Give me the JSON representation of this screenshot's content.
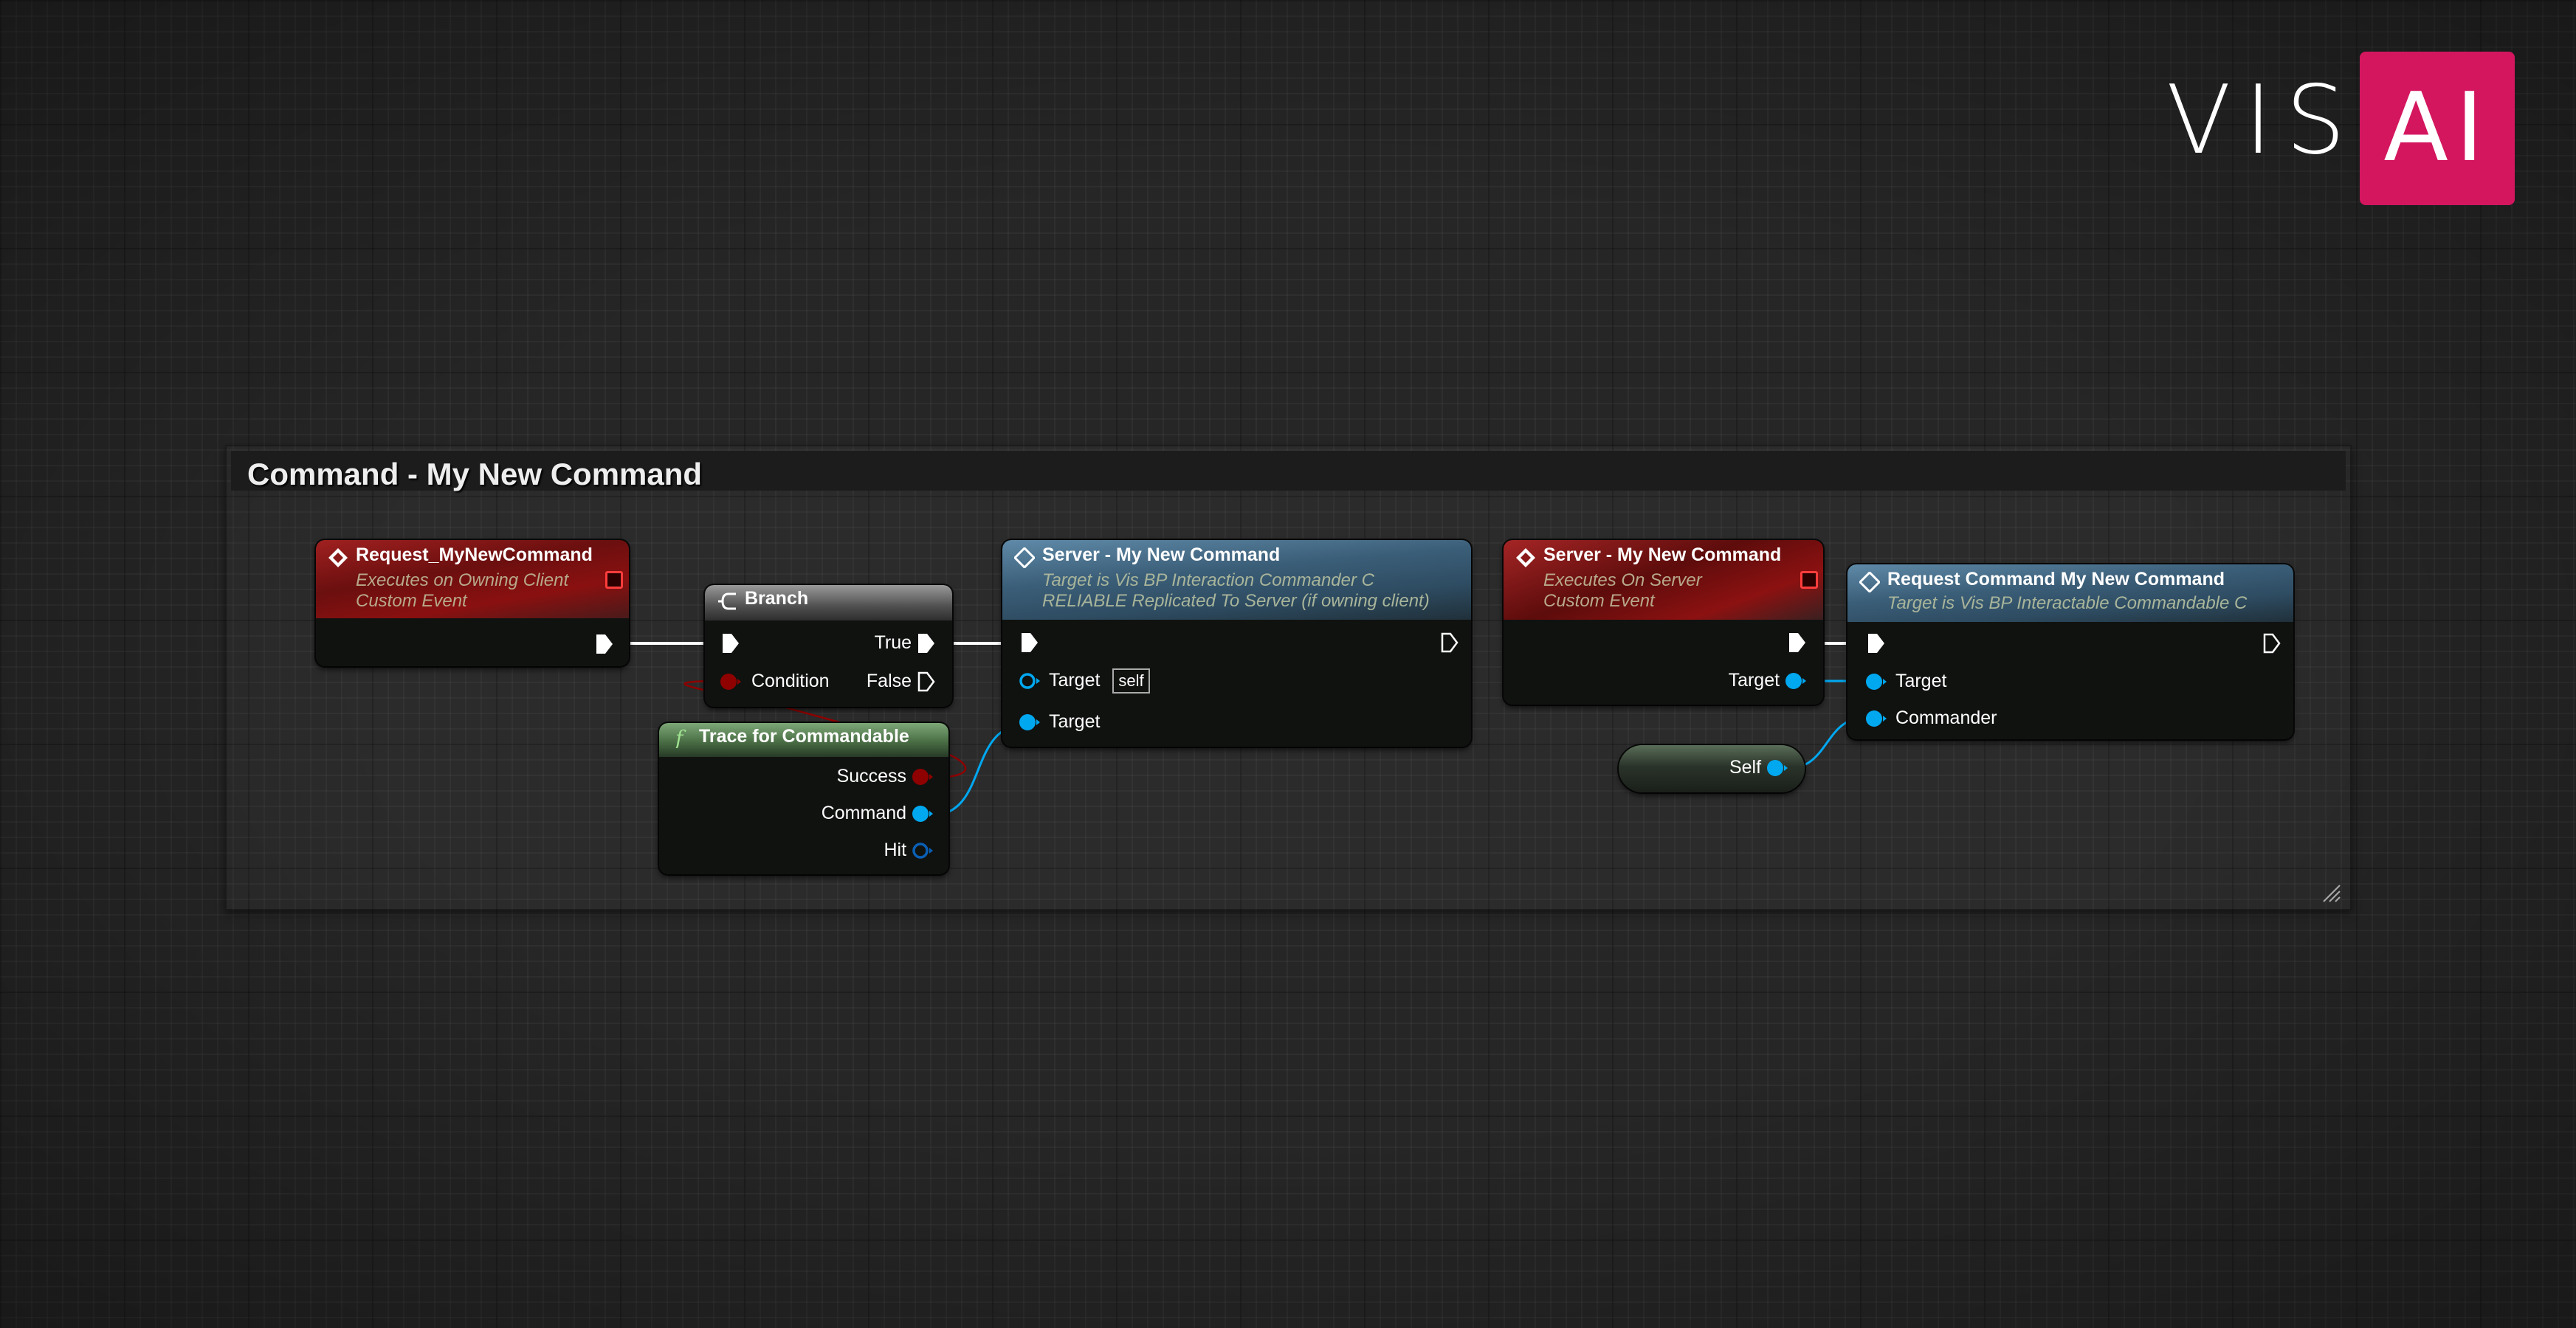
{
  "logo": {
    "left": "VIS",
    "right": "AI",
    "accent_color": "#d4165f"
  },
  "comment": {
    "title": "Command - My New Command"
  },
  "nodes": {
    "request_event": {
      "title": "Request_MyNewCommand",
      "subtitle_1": "Executes on Owning Client",
      "subtitle_2": "Custom Event",
      "icon": "custom-event-icon"
    },
    "branch": {
      "title": "Branch",
      "pins": {
        "condition": "Condition",
        "true": "True",
        "false": "False"
      },
      "icon": "branch-icon"
    },
    "trace": {
      "title": "Trace for Commandable",
      "pins": {
        "success": "Success",
        "command": "Command",
        "hit": "Hit"
      },
      "icon": "function-icon"
    },
    "server_call": {
      "title": "Server - My New Command",
      "subtitle_1": "Target is Vis BP Interaction Commander C",
      "subtitle_2": "RELIABLE Replicated To Server (if owning client)",
      "pins": {
        "target_self": "Target",
        "self_default": "self",
        "target": "Target"
      },
      "icon": "event-call-icon"
    },
    "server_event": {
      "title": "Server - My New Command",
      "subtitle_1": "Executes On Server",
      "subtitle_2": "Custom Event",
      "pins": {
        "target": "Target"
      },
      "icon": "custom-event-icon"
    },
    "request_command": {
      "title": "Request Command My New Command",
      "subtitle_1": "Target is Vis BP Interactable Commandable C",
      "pins": {
        "target": "Target",
        "commander": "Commander"
      },
      "icon": "event-call-icon"
    },
    "self": {
      "label": "Self"
    }
  },
  "colors": {
    "exec": "#ffffff",
    "bool": "#8f0000",
    "object": "#00a8f0",
    "struct": "#0a5fb4"
  }
}
